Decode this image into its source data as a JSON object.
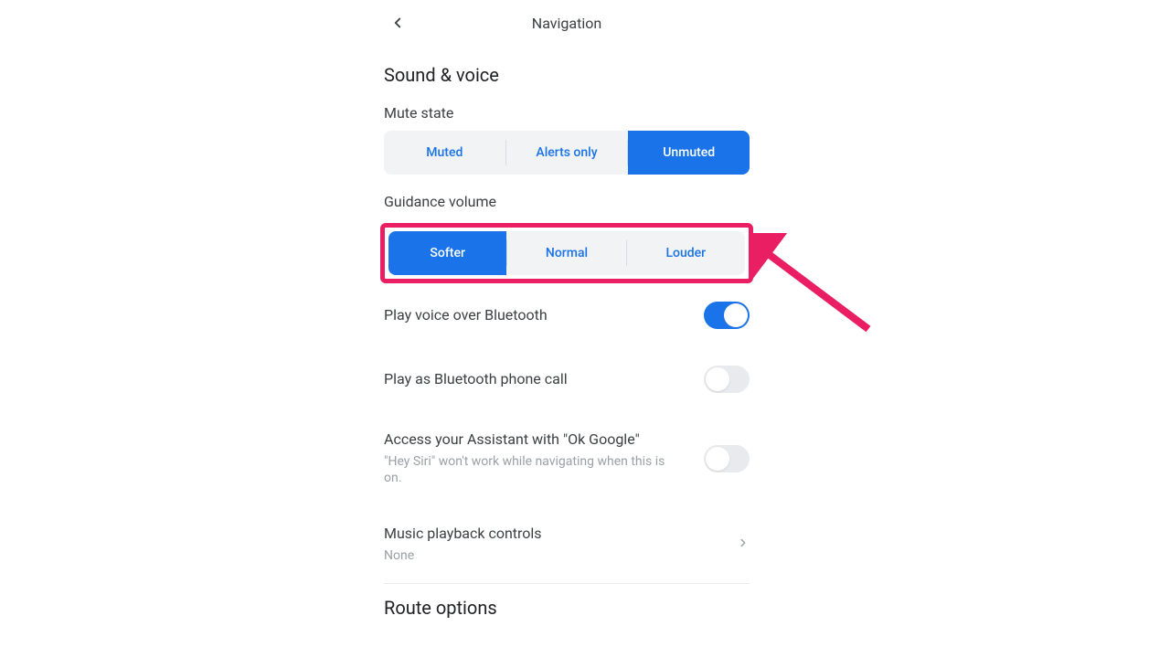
{
  "header": {
    "title": "Navigation"
  },
  "sound_voice": {
    "heading": "Sound & voice",
    "mute_state": {
      "label": "Mute state",
      "options": [
        "Muted",
        "Alerts only",
        "Unmuted"
      ],
      "selected_index": 2
    },
    "guidance_volume": {
      "label": "Guidance volume",
      "options": [
        "Softer",
        "Normal",
        "Louder"
      ],
      "selected_index": 0
    },
    "play_bluetooth": {
      "title": "Play voice over Bluetooth",
      "enabled": true
    },
    "play_as_call": {
      "title": "Play as Bluetooth phone call",
      "enabled": false
    },
    "assistant": {
      "title": "Access your Assistant with \"Ok Google\"",
      "subtitle": "\"Hey Siri\" won't work while navigating when this is on.",
      "enabled": false
    },
    "music_playback": {
      "title": "Music playback controls",
      "value": "None"
    }
  },
  "route_options": {
    "heading": "Route options"
  },
  "annotation": {
    "highlight_target": "guidance_volume",
    "color": "#e91e63"
  }
}
